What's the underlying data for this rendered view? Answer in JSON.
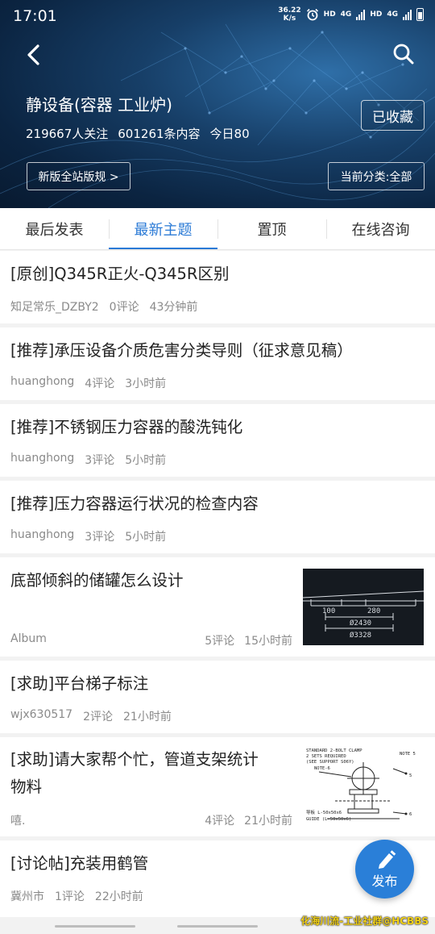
{
  "status": {
    "time": "17:01",
    "speed_value": "36.22",
    "speed_unit": "K/s",
    "hd1": "HD",
    "net1": "4G",
    "hd2": "HD",
    "net2": "4G"
  },
  "header": {
    "title": "静设备(容器 工业炉)",
    "followers": "219667人关注",
    "contents": "601261条内容",
    "today": "今日80",
    "favorite_label": "已收藏",
    "rules_label": "新版全站版规 >",
    "category_label": "当前分类:全部"
  },
  "tabs": [
    {
      "label": "最后发表",
      "active": false
    },
    {
      "label": "最新主题",
      "active": true
    },
    {
      "label": "置顶",
      "active": false
    },
    {
      "label": "在线咨询",
      "active": false
    }
  ],
  "posts": [
    {
      "title": "[原创]Q345R正火-Q345R区别",
      "author": "知足常乐_DZBY2",
      "comments": "0评论",
      "time": "43分钟前"
    },
    {
      "title": "[推荐]承压设备介质危害分类导则（征求意见稿）",
      "author": "huanghong",
      "comments": "4评论",
      "time": "3小时前"
    },
    {
      "title": "[推荐]不锈钢压力容器的酸洗钝化",
      "author": "huanghong",
      "comments": "3评论",
      "time": "5小时前"
    },
    {
      "title": "[推荐]压力容器运行状况的检查内容",
      "author": "huanghong",
      "comments": "3评论",
      "time": "5小时前"
    },
    {
      "title": "底部倾斜的储罐怎么设计",
      "author": "Album",
      "comments": "5评论",
      "time": "15小时前",
      "thumb_text": [
        "100",
        "280",
        "Ø2430",
        "Ø3328"
      ]
    },
    {
      "title": "[求助]平台梯子标注",
      "author": "wjx630517",
      "comments": "2评论",
      "time": "21小时前"
    },
    {
      "title_line1": "[求助]请大家帮个忙，管道支架统计",
      "title_line2": "物料",
      "author": "嘻.",
      "comments": "4评论",
      "time": "21小时前",
      "thumb_text": [
        "STANDARD 2-BOLT CLAMP",
        "2 SETS REQUIRED",
        "(SEE SUPPORT S06Y)",
        "NOTE-6",
        "NOTE 5",
        "5",
        "6",
        "导板 L-50x50x6",
        "GUIDE (L-50x50x6)"
      ]
    },
    {
      "title": "[讨论帖]充装用鹤管",
      "author": "冀州市",
      "comments": "1评论",
      "time": "22小时前"
    }
  ],
  "fab": {
    "label": "发布"
  },
  "watermark": "化海川流-工业社群@HCBBS",
  "colors": {
    "accent": "#2a7ad6",
    "header_dark": "#0b2441",
    "meta_gray": "#8a8a8a",
    "watermark": "#f3d21a"
  }
}
